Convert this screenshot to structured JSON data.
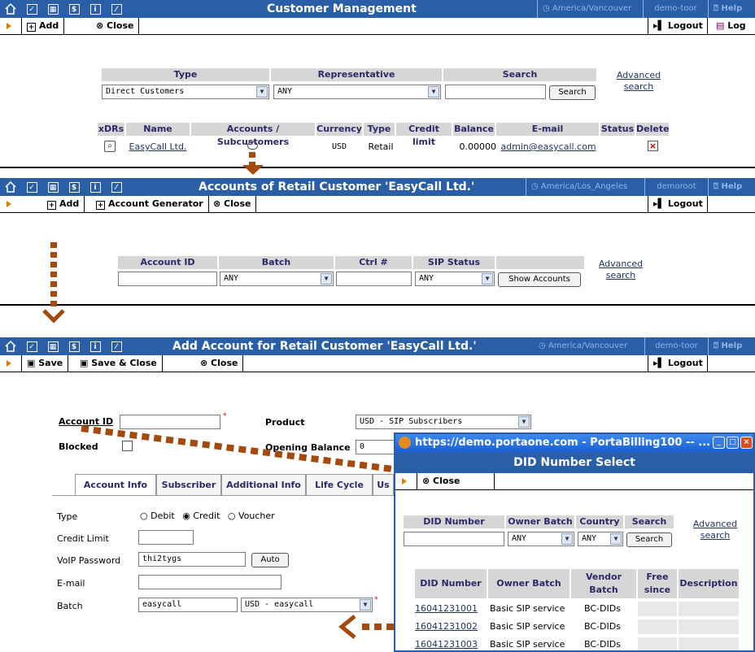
{
  "panel1": {
    "title": "Customer Management",
    "timezone": "America/Vancouver",
    "user": "demo-toor",
    "help": "Help",
    "tools": {
      "add": "Add",
      "close": "Close",
      "logout": "Logout",
      "log": "Log"
    },
    "search_headers": [
      "Type",
      "Representative",
      "Search"
    ],
    "type_value": "Direct Customers",
    "rep_value": "ANY",
    "search_button": "Search",
    "advanced_search": [
      "Advanced",
      "search"
    ],
    "columns": [
      "xDRs",
      "Name",
      "Accounts / Subcustomers",
      "Currency",
      "Type",
      "Credit limit",
      "Balance",
      "E-mail",
      "Status",
      "Delete"
    ],
    "row": {
      "name": "EasyCall Ltd.",
      "currency": "USD",
      "type": "Retail",
      "credit_limit": "",
      "balance": "0.00000",
      "email": "admin@easycall.com",
      "status": ""
    }
  },
  "panel2": {
    "title": "Accounts of Retail Customer 'EasyCall Ltd.'",
    "timezone": "America/Los_Angeles",
    "user": "demoroot",
    "help": "Help",
    "tools": {
      "add": "Add",
      "generator": "Account Generator",
      "close": "Close",
      "logout": "Logout"
    },
    "headers": [
      "Account ID",
      "Batch",
      "Ctrl #",
      "SIP Status"
    ],
    "batch_value": "ANY",
    "sip_value": "ANY",
    "show_button": "Show Accounts",
    "advanced_search": [
      "Advanced",
      "search"
    ]
  },
  "panel3": {
    "title": "Add Account for Retail Customer 'EasyCall Ltd.'",
    "timezone": "America/Vancouver",
    "user": "demo-toor",
    "help": "Help",
    "tools": {
      "save": "Save",
      "save_close": "Save & Close",
      "close": "Close",
      "logout": "Logout"
    },
    "account_id_label": "Account ID",
    "product_label": "Product",
    "product_value": "USD - SIP Subscribers",
    "blocked_label": "Blocked",
    "opening_balance_label": "Opening Balance",
    "opening_balance_value": "0",
    "tabs": [
      "Account Info",
      "Subscriber",
      "Additional Info",
      "Life Cycle",
      "Us"
    ],
    "type_label": "Type",
    "type_options": [
      "Debit",
      "Credit",
      "Voucher"
    ],
    "credit_limit_label": "Credit Limit",
    "voip_password_label": "VoIP Password",
    "voip_password_value": "thi2tygs",
    "auto_button": "Auto",
    "email_label": "E-mail",
    "batch_label": "Batch",
    "batch_value": "easycall",
    "batch_select": "USD - easycall"
  },
  "popup": {
    "window_title": "https://demo.portaone.com - PortaBilling100 -- ...",
    "header": "DID Number Select",
    "close": "Close",
    "search_headers": [
      "DID Number",
      "Owner Batch",
      "Country",
      "Search"
    ],
    "owner_value": "ANY",
    "country_value": "ANY",
    "search_button": "Search",
    "advanced_search": [
      "Advanced",
      "search"
    ],
    "columns": [
      "DID Number",
      "Owner Batch",
      "Vendor Batch",
      "Free since",
      "Description"
    ],
    "rows": [
      {
        "did": "16041231001",
        "owner": "Basic SIP service",
        "vendor": "BC-DIDs"
      },
      {
        "did": "16041231002",
        "owner": "Basic SIP service",
        "vendor": "BC-DIDs"
      },
      {
        "did": "16041231003",
        "owner": "Basic SIP service",
        "vendor": "BC-DIDs"
      }
    ]
  },
  "colors": {
    "titlebar": "#2a5fa8",
    "accent_arrow": "#a34a0c",
    "tool_arrow": "#e07b00"
  }
}
